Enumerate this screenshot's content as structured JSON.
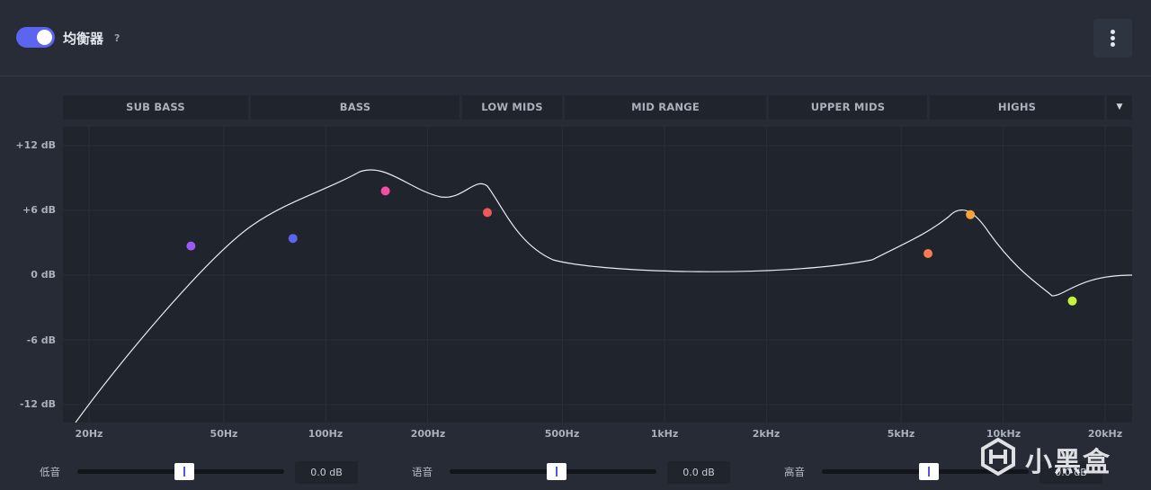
{
  "header": {
    "title": "均衡器",
    "help": "?",
    "toggle_on": true,
    "accent_color": "#5b65f0"
  },
  "bands": [
    {
      "label": "SUB BASS"
    },
    {
      "label": "BASS"
    },
    {
      "label": "LOW MIDS"
    },
    {
      "label": "MID RANGE"
    },
    {
      "label": "UPPER MIDS"
    },
    {
      "label": "HIGHS"
    }
  ],
  "band_dropdown_icon": "caret-down-icon",
  "graph": {
    "y_labels": [
      "+12 dB",
      "+6 dB",
      "0 dB",
      "-6 dB",
      "-12 dB"
    ],
    "x_labels": [
      "20Hz",
      "50Hz",
      "100Hz",
      "200Hz",
      "500Hz",
      "1kHz",
      "2kHz",
      "5kHz",
      "10kHz",
      "20kHz"
    ],
    "curve_color": "#e9ebef",
    "points": [
      {
        "freq": "40Hz",
        "gain_db": 2.7,
        "color": "#9b59f5"
      },
      {
        "freq": "80Hz",
        "gain_db": 3.4,
        "color": "#5b65f0"
      },
      {
        "freq": "150Hz",
        "gain_db": 7.8,
        "color": "#f24fa6"
      },
      {
        "freq": "300Hz",
        "gain_db": 5.8,
        "color": "#f25757"
      },
      {
        "freq": "6kHz",
        "gain_db": 2.0,
        "color": "#fb7a52"
      },
      {
        "freq": "8kHz",
        "gain_db": 5.6,
        "color": "#fba23a"
      },
      {
        "freq": "16kHz",
        "gain_db": -2.4,
        "color": "#c6f23a"
      }
    ]
  },
  "sliders": [
    {
      "label": "低音",
      "value": "0.0 dB",
      "level_pct": 50
    },
    {
      "label": "语音",
      "value": "0.0 dB",
      "level_pct": 50
    },
    {
      "label": "高音",
      "value": "0.0 dB",
      "level_pct": 50
    }
  ],
  "watermark": {
    "text": "小黑盒"
  }
}
